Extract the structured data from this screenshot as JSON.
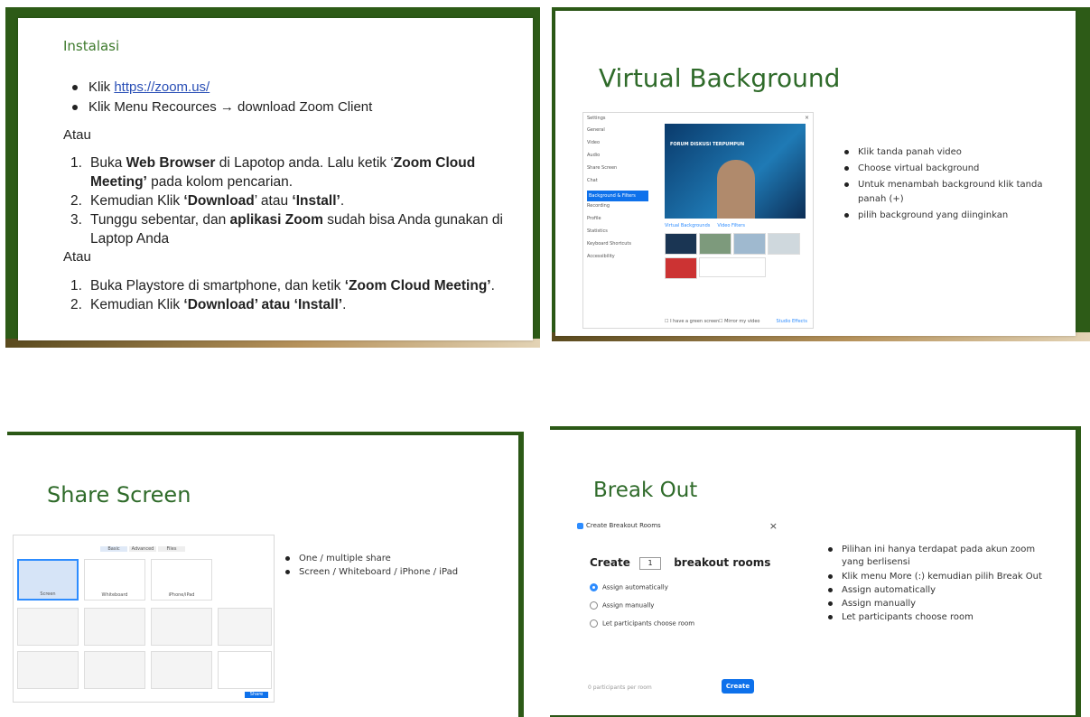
{
  "slide1": {
    "subtitle": "Instalasi",
    "bullets": [
      {
        "prefix": "Klik ",
        "link": "https://zoom.us/"
      },
      {
        "text": "Klik Menu Recources → download Zoom Client"
      }
    ],
    "atau1": "Atau",
    "steps1": [
      {
        "num": "1.",
        "line1": "Buka ",
        "bold1": "Web Browser",
        "line1b": " di Lapotop anda. Lalu ketik ‘",
        "bold1b": "Zoom Cloud",
        "line2bold": "Meeting’",
        "line2": " pada kolom pencarian."
      },
      {
        "num": "2.",
        "pre": "Kemudian Klik ",
        "b1": "‘Download",
        "mid": "’ atau ",
        "b2": "‘Install’",
        "post": "."
      },
      {
        "num": "3.",
        "pre": "Tunggu sebentar, dan ",
        "b1": "aplikasi Zoom",
        "post": " sudah bisa Anda gunakan di",
        "line2": "Laptop Anda"
      }
    ],
    "atau2": "Atau",
    "steps2": [
      {
        "num": "1.",
        "pre": "Buka Playstore di smartphone, dan ketik ",
        "b1": "‘Zoom Cloud Meeting’",
        "post": "."
      },
      {
        "num": "2.",
        "pre": "Kemudian Klik ",
        "b1": "‘Download’ atau ‘Install’",
        "post": "."
      }
    ]
  },
  "slide2": {
    "title": "Virtual Background",
    "bullets": [
      "Klik tanda panah video",
      "Choose virtual background",
      "Untuk menambah background klik tanda",
      "panah (+)",
      "pilih background yang diinginkan"
    ],
    "settings": {
      "window_title": "Settings",
      "menu": [
        "General",
        "Video",
        "Audio",
        "Share Screen",
        "Chat",
        "Background & Filters",
        "Recording",
        "Profile",
        "Statistics",
        "Keyboard Shortcuts",
        "Accessibility"
      ],
      "tabs": [
        "Virtual Backgrounds",
        "Video Filters"
      ],
      "preview_caption": "FORUM DISKUSI TERPUMPUN",
      "mirror": "Mirror my video",
      "green": "I have a green screen",
      "studio": "Studio Effects"
    }
  },
  "slide3": {
    "title": "Share Screen",
    "bullets": [
      "One / multiple share",
      "Screen / Whiteboard / iPhone / iPad"
    ],
    "dialog": {
      "tabs": [
        "Basic",
        "Advanced",
        "Files"
      ],
      "items": [
        "Screen",
        "Whiteboard",
        "iPhone/iPad"
      ],
      "share_button": "Share"
    }
  },
  "slide4": {
    "title": "Break Out",
    "dialog": {
      "window_title": "Create Breakout Rooms",
      "create": "Create",
      "count": "1",
      "rooms": "breakout rooms",
      "options": [
        "Assign automatically",
        "Assign manually",
        "Let participants choose room"
      ],
      "per_room": "0 participants per room",
      "button": "Create"
    },
    "bullets": [
      "Pilihan ini hanya terdapat pada akun zoom",
      "yang berlisensi",
      "Klik menu More (:) kemudian pilih Break Out",
      "Assign automatically",
      "Assign manually",
      "Let participants choose room"
    ]
  }
}
